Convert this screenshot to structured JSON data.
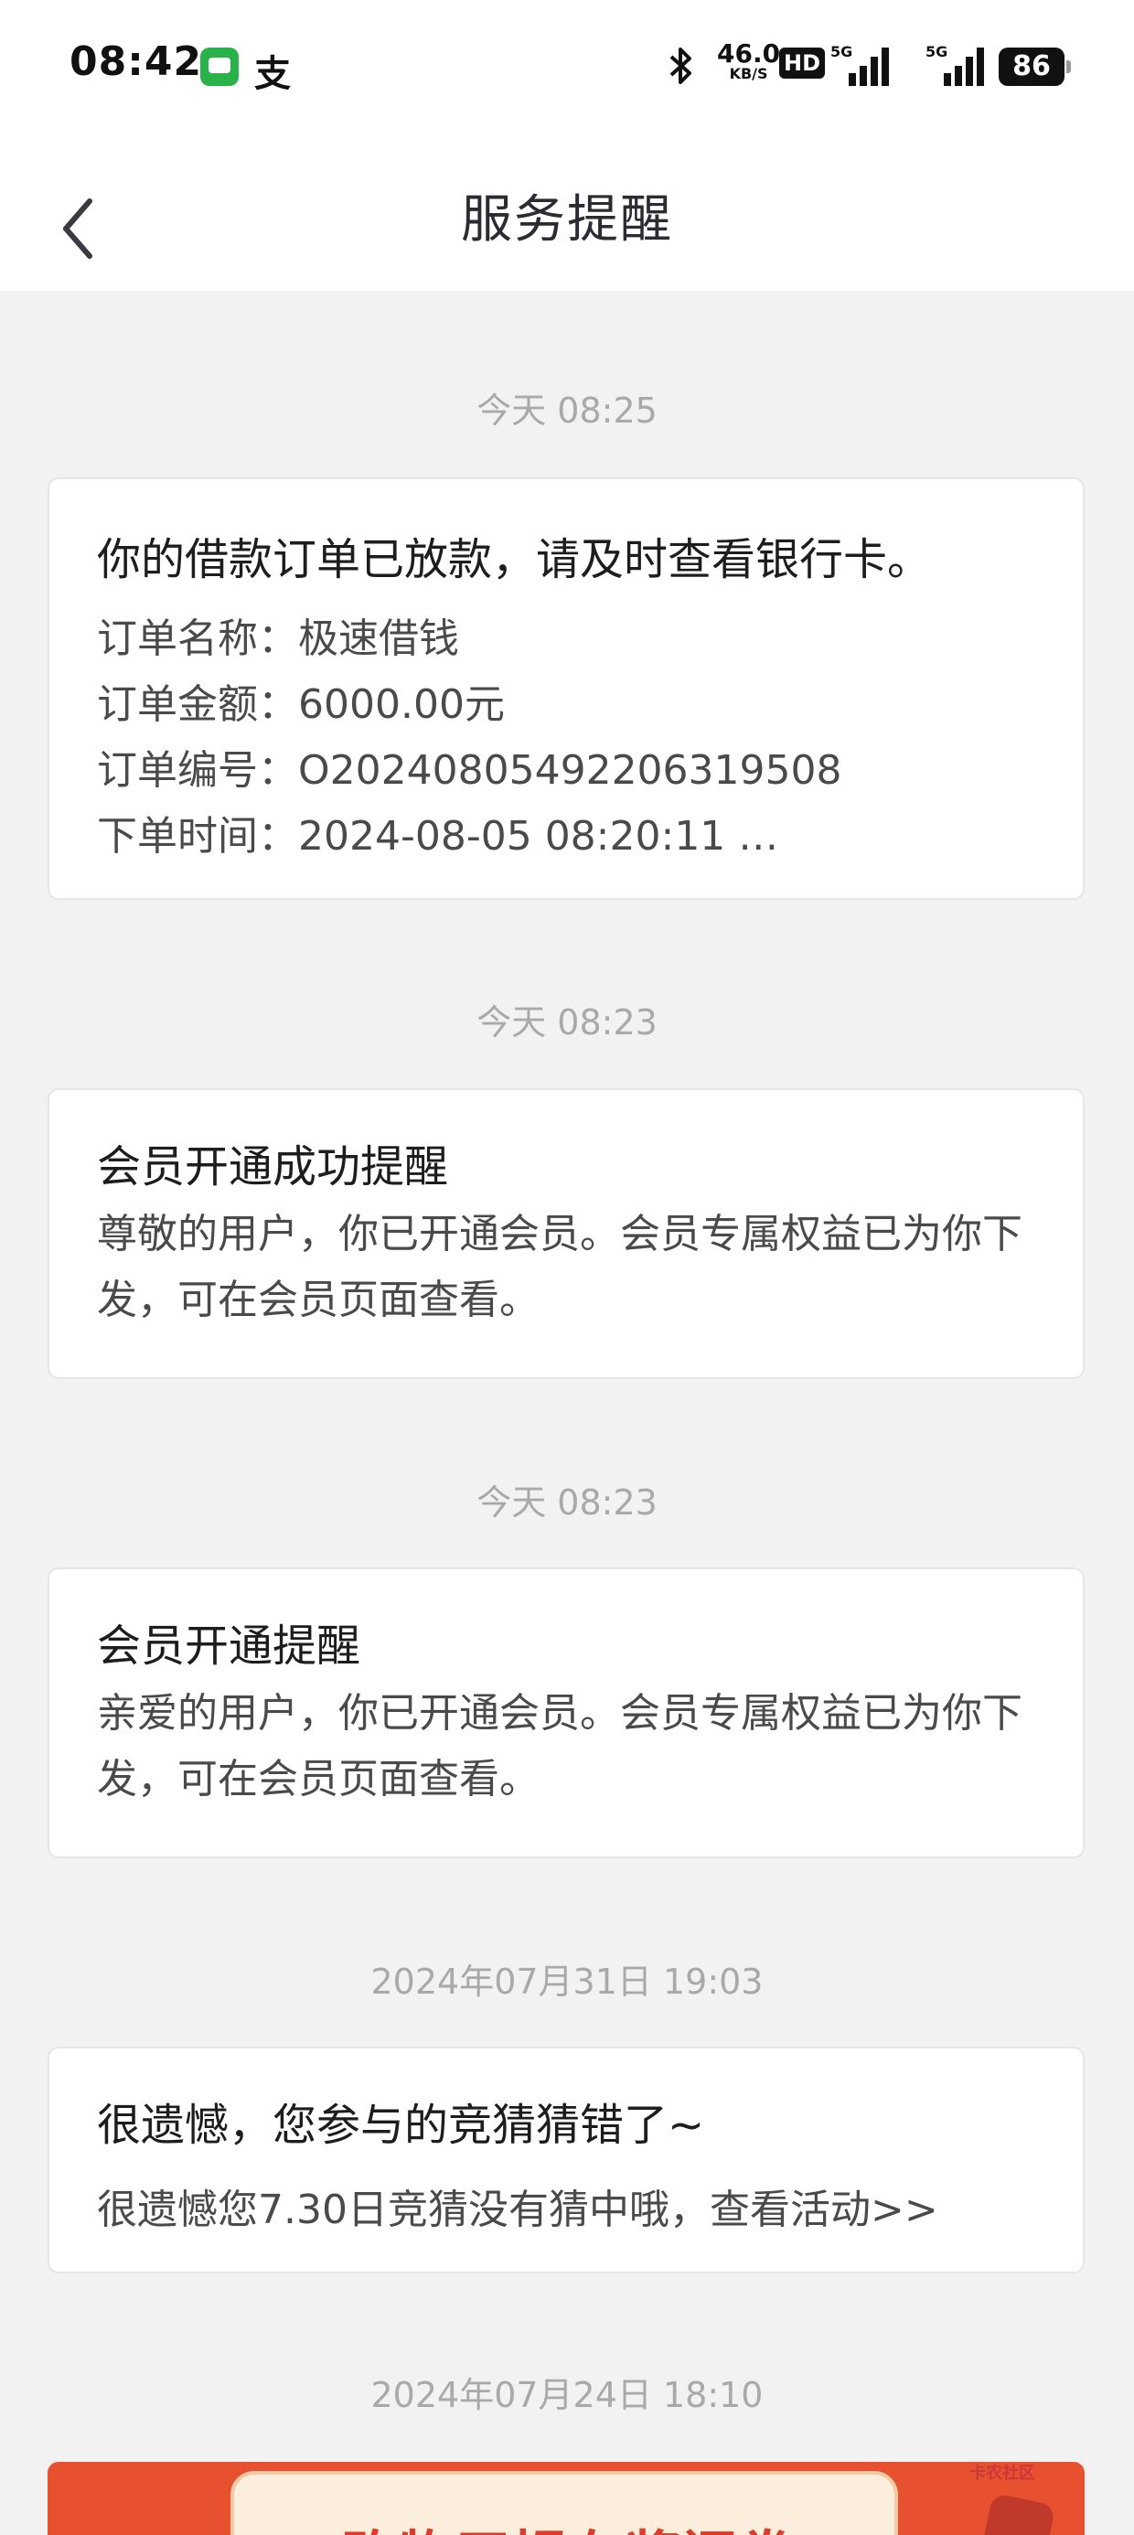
{
  "status_bar": {
    "time": "08:42",
    "app2_glyph": "支",
    "speed_value": "46.0",
    "speed_unit": "KB/S",
    "hd": "HD",
    "signal1_label": "5G",
    "signal2_label": "5G",
    "battery": "86"
  },
  "header": {
    "title": "服务提醒"
  },
  "messages": [
    {
      "time": "今天 08:25",
      "title": "你的借款订单已放款，请及时查看银行卡。",
      "lines": [
        "订单名称：极速借钱",
        "订单金额：6000.00元",
        "订单编号：O2024080549220631​9508",
        "下单时间：2024-08-05 08:20:11 …"
      ]
    },
    {
      "time": "今天 08:23",
      "title": "会员开通成功提醒",
      "body": "尊敬的用户，你已开通会员。会员专属权益已为你下发，可在会员页面查看。"
    },
    {
      "time": "今天 08:23",
      "title": "会员开通提醒",
      "body": "亲爱的用户，你已开通会员。会员专属权益已为你下发，可在会员页面查看。"
    },
    {
      "time": "2024年07月31日 19:03",
      "title": "很遗憾，您参与的竞猜猜错了~",
      "body": "很遗憾您7.30日竞猜没有猜中哦，查看活动>>"
    },
    {
      "time": "2024年07月24日 18:10",
      "banner_text": "购物习惯有奖问卷"
    }
  ],
  "watermark": "卡农社区",
  "colors": {
    "background": "#f2f2f2",
    "card": "#ffffff",
    "timestamp": "#a9a9a9",
    "banner": "#e8512f"
  }
}
